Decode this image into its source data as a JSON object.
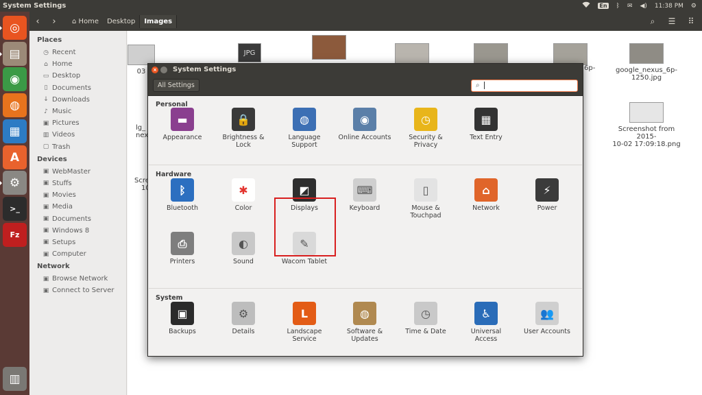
{
  "top_panel": {
    "title": "System Settings",
    "keyboard_layout": "En",
    "time": "11:38 PM"
  },
  "launcher": {
    "items": [
      {
        "name": "Dash",
        "icon": "ubuntu-dash-icon",
        "glyph": "◎",
        "color": "#e95420"
      },
      {
        "name": "Files",
        "icon": "files-icon",
        "glyph": "▤",
        "color": "#9c8a78"
      },
      {
        "name": "Chrome",
        "icon": "chrome-icon",
        "glyph": "◉",
        "color": "#3b9a46"
      },
      {
        "name": "Firefox",
        "icon": "firefox-icon",
        "glyph": "◍",
        "color": "#e8731d"
      },
      {
        "name": "LibreOffice Writer",
        "icon": "writer-icon",
        "glyph": "▦",
        "color": "#2d7bc4"
      },
      {
        "name": "Software Center",
        "icon": "software-center-icon",
        "glyph": "A",
        "color": "#e9622d"
      },
      {
        "name": "System Settings",
        "icon": "settings-icon",
        "glyph": "⚙",
        "color": "#8a8884"
      },
      {
        "name": "Terminal",
        "icon": "terminal-icon",
        "glyph": ">_",
        "color": "#2c2c2c"
      },
      {
        "name": "FileZilla",
        "icon": "filezilla-icon",
        "glyph": "Fz",
        "color": "#bf1f1f"
      }
    ],
    "trash": {
      "name": "Trash",
      "icon": "trash-icon",
      "glyph": "🗑",
      "color": "#7a7874"
    }
  },
  "nautilus": {
    "breadcrumbs": [
      {
        "label": "Home",
        "icon": "home-icon"
      },
      {
        "label": "Desktop"
      },
      {
        "label": "Images",
        "active": true
      }
    ],
    "sidebar": {
      "places_heading": "Places",
      "places": [
        {
          "label": "Recent",
          "icon": "recent-icon",
          "glyph": "◷"
        },
        {
          "label": "Home",
          "icon": "home-icon",
          "glyph": "⌂"
        },
        {
          "label": "Desktop",
          "icon": "desktop-icon",
          "glyph": "▭"
        },
        {
          "label": "Documents",
          "icon": "documents-icon",
          "glyph": "▯"
        },
        {
          "label": "Downloads",
          "icon": "downloads-icon",
          "glyph": "↓"
        },
        {
          "label": "Music",
          "icon": "music-icon",
          "glyph": "♪"
        },
        {
          "label": "Pictures",
          "icon": "pictures-icon",
          "glyph": "▣"
        },
        {
          "label": "Videos",
          "icon": "videos-icon",
          "glyph": "▥"
        },
        {
          "label": "Trash",
          "icon": "trash-icon",
          "glyph": "▢"
        }
      ],
      "devices_heading": "Devices",
      "devices": [
        {
          "label": "WebMaster",
          "icon": "drive-icon",
          "glyph": "▣"
        },
        {
          "label": "Stuffs",
          "icon": "drive-icon",
          "glyph": "▣"
        },
        {
          "label": "Movies",
          "icon": "drive-icon",
          "glyph": "▣"
        },
        {
          "label": "Media",
          "icon": "drive-icon",
          "glyph": "▣"
        },
        {
          "label": "Documents",
          "icon": "drive-icon",
          "glyph": "▣"
        },
        {
          "label": "Windows 8",
          "icon": "drive-icon",
          "glyph": "▣"
        },
        {
          "label": "Setups",
          "icon": "drive-icon",
          "glyph": "▣"
        },
        {
          "label": "Computer",
          "icon": "computer-icon",
          "glyph": "▣"
        }
      ],
      "network_heading": "Network",
      "network": [
        {
          "label": "Browse Network",
          "icon": "network-icon",
          "glyph": "▣"
        },
        {
          "label": "Connect to Server",
          "icon": "server-icon",
          "glyph": "▣"
        }
      ]
    },
    "files": [
      {
        "name": "03",
        "lines": [
          "03"
        ]
      },
      {
        "name": "JPG",
        "lines": [
          ""
        ]
      },
      {
        "name": "google_nexus_6p-1250.jpg",
        "lines": [
          "google_nexus_6p-",
          "1250.jpg"
        ]
      },
      {
        "name": "Screenshot from 2015-10-02 17:09:18.png",
        "lines": [
          "Screenshot from 2015-",
          "10-02 17:09:18.png"
        ]
      },
      {
        "name": "lg_nex",
        "lines": [
          "lg_",
          "nex"
        ]
      },
      {
        "name": "Scre 10",
        "lines": [
          "Scre",
          "10"
        ]
      },
      {
        "name": "6p",
        "lines": [
          "6p-"
        ]
      }
    ],
    "jpg_badge": "JPG"
  },
  "dialog": {
    "title": "System Settings",
    "all_settings": "All Settings",
    "search_placeholder": "",
    "sections": [
      {
        "title": "Personal",
        "items": [
          {
            "label": [
              "Appearance"
            ],
            "icon": "appearance-icon",
            "color": "#8a3f8f",
            "glyph": "▬"
          },
          {
            "label": [
              "Brightness &",
              "Lock"
            ],
            "icon": "brightness-lock-icon",
            "color": "#3a3a3a",
            "glyph": "🔒"
          },
          {
            "label": [
              "Language",
              "Support"
            ],
            "icon": "language-support-icon",
            "color": "#3c6fb4",
            "glyph": "◍"
          },
          {
            "label": [
              "Online Accounts"
            ],
            "icon": "online-accounts-icon",
            "color": "#5b7fa8",
            "glyph": "◉"
          },
          {
            "label": [
              "Security &",
              "Privacy"
            ],
            "icon": "security-privacy-icon",
            "color": "#e8b51a",
            "glyph": "◷"
          },
          {
            "label": [
              "Text Entry"
            ],
            "icon": "text-entry-icon",
            "color": "#333333",
            "glyph": "▦"
          }
        ]
      },
      {
        "title": "Hardware",
        "items": [
          {
            "label": [
              "Bluetooth"
            ],
            "icon": "bluetooth-icon",
            "color": "#2c6fc0",
            "glyph": "ᛒ"
          },
          {
            "label": [
              "Color"
            ],
            "icon": "color-icon",
            "color": "#ffffff",
            "glyph": "✱"
          },
          {
            "label": [
              "Displays"
            ],
            "icon": "displays-icon",
            "color": "#2e2e2e",
            "glyph": "◩"
          },
          {
            "label": [
              "Keyboard"
            ],
            "icon": "keyboard-icon",
            "color": "#cfcfcf",
            "glyph": "⌨"
          },
          {
            "label": [
              "Mouse &",
              "Touchpad"
            ],
            "icon": "mouse-touchpad-icon",
            "color": "#e3e3e3",
            "glyph": "▯"
          },
          {
            "label": [
              "Network"
            ],
            "icon": "network-settings-icon",
            "color": "#e0652a",
            "glyph": "⌂"
          },
          {
            "label": [
              "Power"
            ],
            "icon": "power-icon",
            "color": "#3b3b3b",
            "glyph": "⚡"
          },
          {
            "label": [
              "Printers"
            ],
            "icon": "printers-icon",
            "color": "#7e7e7e",
            "glyph": "⎙"
          },
          {
            "label": [
              "Sound"
            ],
            "icon": "sound-icon",
            "color": "#c8c8c8",
            "glyph": "◐"
          },
          {
            "label": [
              "Wacom Tablet"
            ],
            "icon": "wacom-tablet-icon",
            "color": "#d9d9d9",
            "glyph": "✎"
          }
        ]
      },
      {
        "title": "System",
        "items": [
          {
            "label": [
              "Backups"
            ],
            "icon": "backups-icon",
            "color": "#2b2b2b",
            "glyph": "▣"
          },
          {
            "label": [
              "Details"
            ],
            "icon": "details-icon",
            "color": "#bdbdbd",
            "glyph": "⚙"
          },
          {
            "label": [
              "Landscape",
              "Service"
            ],
            "icon": "landscape-service-icon",
            "color": "#e35c16",
            "glyph": "L"
          },
          {
            "label": [
              "Software &",
              "Updates"
            ],
            "icon": "software-updates-icon",
            "color": "#b08950",
            "glyph": "◍"
          },
          {
            "label": [
              "Time & Date"
            ],
            "icon": "time-date-icon",
            "color": "#c9c9c9",
            "glyph": "◷"
          },
          {
            "label": [
              "Universal",
              "Access"
            ],
            "icon": "universal-access-icon",
            "color": "#2a6cb8",
            "glyph": "♿"
          },
          {
            "label": [
              "User Accounts"
            ],
            "icon": "user-accounts-icon",
            "color": "#cfcfcf",
            "glyph": "👥"
          }
        ]
      }
    ]
  },
  "colors": {
    "panel": "#3c3b37",
    "launcher": "#5a3a35",
    "accent": "#f07746",
    "highlight": "#d81e1e"
  }
}
